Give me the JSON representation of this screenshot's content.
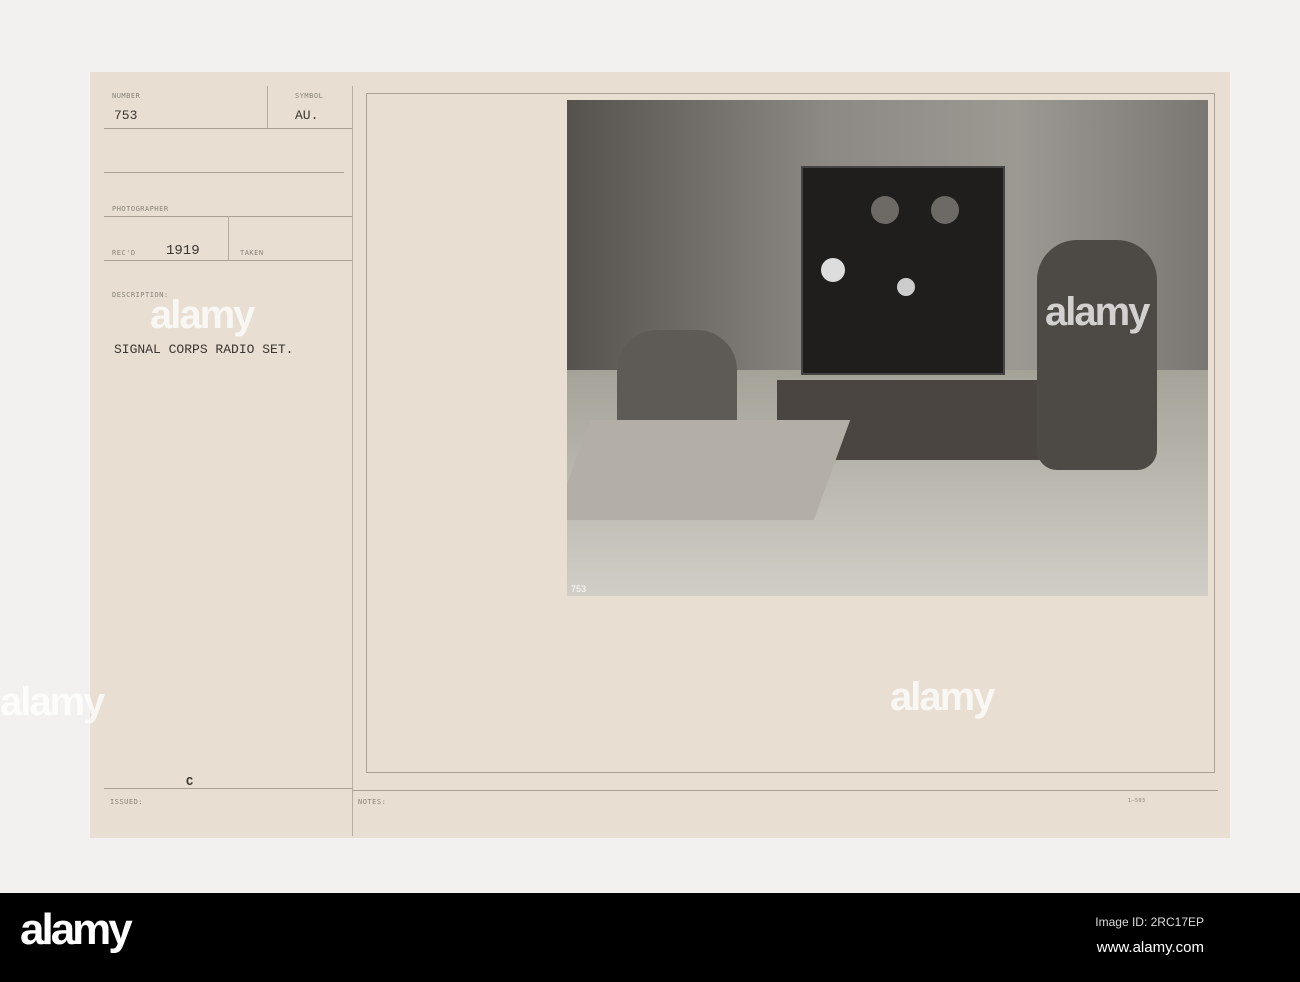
{
  "card": {
    "number_label": "NUMBER",
    "number": "753",
    "symbol_label": "SYMBOL",
    "symbol": "AU.",
    "photographer_label": "PHOTOGRAPHER",
    "recd_label": "REC'D",
    "recd": "1919",
    "taken_label": "TAKEN",
    "description_label": "DESCRIPTION:",
    "description": "SIGNAL CORPS RADIO SET.",
    "issued_label": "ISSUED:",
    "issued": "C",
    "notes_label": "NOTES:",
    "form_code": "1—503",
    "photo_number": "753"
  },
  "watermark": "alamy",
  "footer": {
    "logo": "alamy",
    "image_id": "Image ID: 2RC17EP",
    "url": "www.alamy.com"
  }
}
